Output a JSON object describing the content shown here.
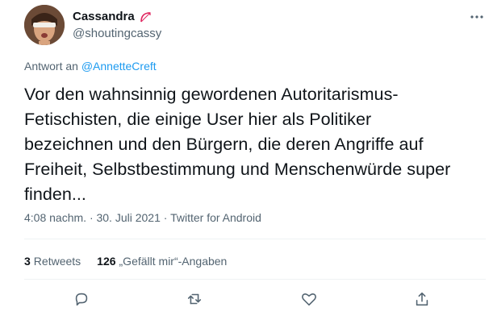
{
  "author": {
    "display_name": "Cassandra",
    "handle": "@shoutingcassy"
  },
  "reply_to": {
    "prefix": "Antwort an",
    "user": "@AnnetteCreft"
  },
  "tweet": {
    "text": "Vor den wahnsinnig gewordenen Autoritarismus-\nFetischisten, die einige User hier als Politiker\nbezeichnen und den Bürgern, die deren Angriffe auf\nFreiheit, Selbstbestimmung und Menschenwürde super\nfinden...",
    "meta": "4:08 nachm. · 30. Juli 2021 · Twitter for Android"
  },
  "stats": {
    "retweets_count": "3",
    "retweets_label": "Retweets",
    "likes_count": "126",
    "likes_label": "„Gefällt mir“-Angaben"
  },
  "icons": {
    "badge": "bow-arrow-icon",
    "more": "more-horizontal-icon",
    "reply": "reply-bubble-icon",
    "retweet": "retweet-icon",
    "like": "heart-icon",
    "share": "share-icon"
  },
  "colors": {
    "link": "#1d9bf0",
    "secondary_text": "#536471",
    "primary_text": "#0f1419",
    "badge": "#e0245e"
  }
}
